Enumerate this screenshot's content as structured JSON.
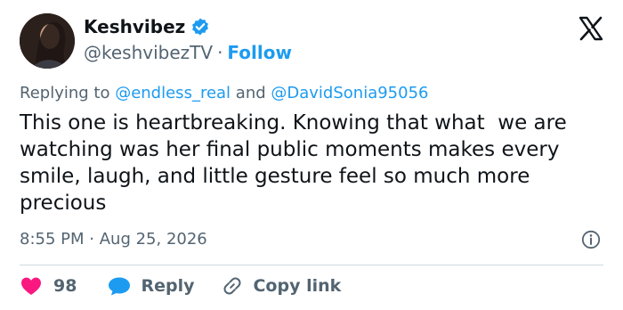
{
  "author": {
    "display_name": "Keshvibez",
    "handle": "@keshvibezTV",
    "follow_label": "Follow",
    "separator": "·",
    "verified_color": "#1d9bf0"
  },
  "reply_context": {
    "prefix": "Replying to ",
    "mention_1": "@endless_real",
    "conjunction": " and ",
    "mention_2": "@DavidSonia95056"
  },
  "tweet": {
    "text": "This one is heartbreaking. Knowing that what  we are watching was her final public moments makes every smile, laugh, and little gesture feel so much more precious",
    "time": "8:55 PM",
    "separator": "·",
    "date": "Aug 25, 2026"
  },
  "actions": {
    "like_count": "98",
    "reply_label": "Reply",
    "copy_link_label": "Copy link"
  },
  "colors": {
    "accent": "#1d9bf0",
    "like": "#f91880",
    "muted": "#536471",
    "text": "#0f1419"
  }
}
